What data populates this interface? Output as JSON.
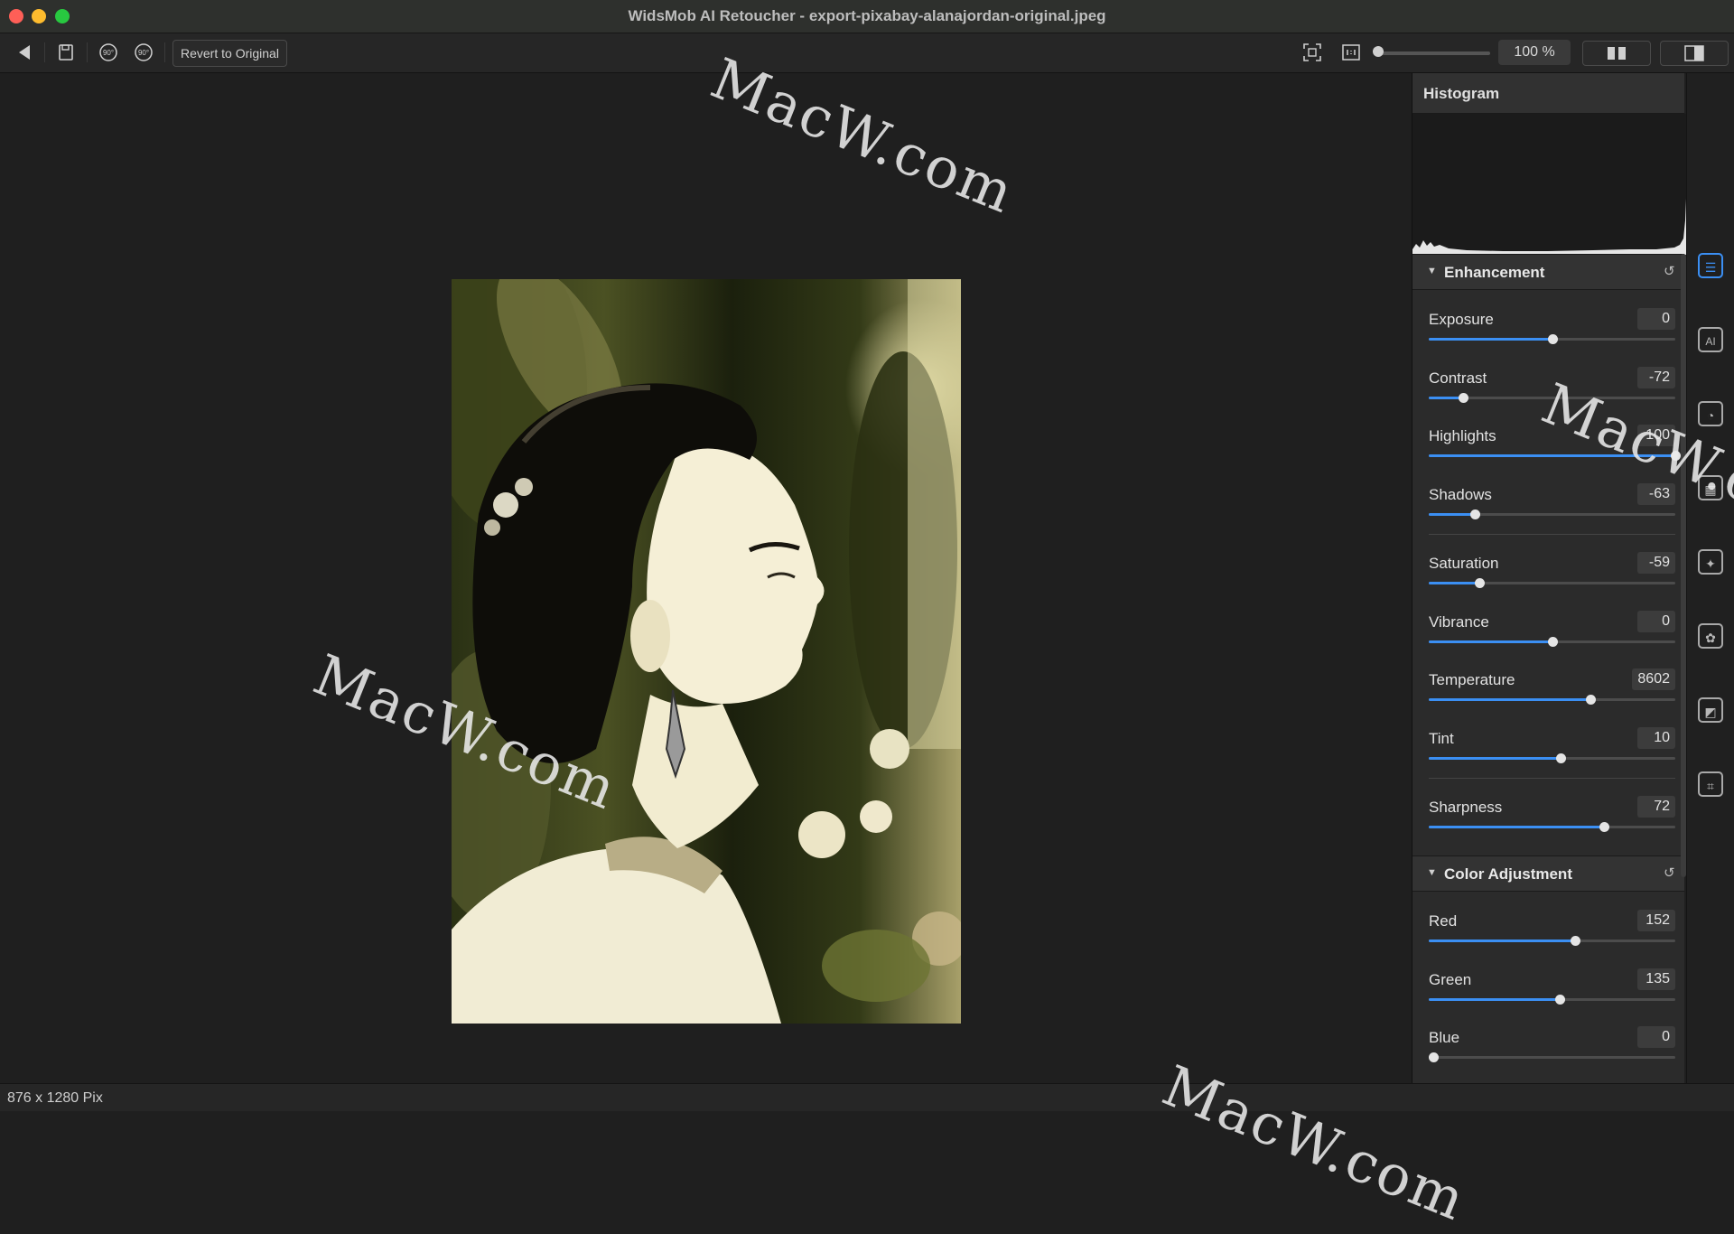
{
  "window": {
    "title": "WidsMob AI Retoucher - export-pixabay-alanajordan-original.jpeg"
  },
  "toolbar": {
    "back_icon": "back-arrow-icon",
    "save_icon": "save-icon",
    "rotate_left_label": "90°",
    "rotate_right_label": "90°",
    "revert_label": "Revert to Original",
    "fit_icon": "fit-to-screen-icon",
    "actual_size_icon": "actual-size-icon",
    "zoom_value": "100 %",
    "zoom_level": 0.0
  },
  "histogram": {
    "title": "Histogram",
    "expand_icon": "expand-icon"
  },
  "enhancement": {
    "title": "Enhancement",
    "reset_icon": "reset-icon",
    "rows": [
      {
        "label": "Exposure",
        "value": "0",
        "fraction": 0.5
      },
      {
        "label": "Contrast",
        "value": "-72",
        "fraction": 0.14
      },
      {
        "label": "Highlights",
        "value": "100",
        "fraction": 1.0
      },
      {
        "label": "Shadows",
        "value": "-63",
        "fraction": 0.185
      },
      {
        "label": "Saturation",
        "value": "-59",
        "fraction": 0.205
      },
      {
        "label": "Vibrance",
        "value": "0",
        "fraction": 0.5
      },
      {
        "label": "Temperature",
        "value": "8602",
        "fraction": 0.655
      },
      {
        "label": "Tint",
        "value": "10",
        "fraction": 0.535
      },
      {
        "label": "Sharpness",
        "value": "72",
        "fraction": 0.71
      }
    ]
  },
  "color_adjustment": {
    "title": "Color Adjustment",
    "reset_icon": "reset-icon",
    "rows": [
      {
        "label": "Red",
        "value": "152",
        "fraction": 0.595
      },
      {
        "label": "Green",
        "value": "135",
        "fraction": 0.53
      },
      {
        "label": "Blue",
        "value": "0",
        "fraction": 0.0
      }
    ]
  },
  "tools": [
    {
      "name": "adjustments-tool",
      "glyph": "☰",
      "active": true
    },
    {
      "name": "ai-tool",
      "glyph": "AI",
      "active": false
    },
    {
      "name": "portrait-tool",
      "glyph": "◔",
      "active": false
    },
    {
      "name": "noise-tool",
      "glyph": "▦",
      "active": false
    },
    {
      "name": "magic-wand-tool",
      "glyph": "✦",
      "active": false
    },
    {
      "name": "filter-tool",
      "glyph": "✿",
      "active": false
    },
    {
      "name": "frame-tool",
      "glyph": "◩",
      "active": false
    },
    {
      "name": "crop-tool",
      "glyph": "⌗",
      "active": false
    }
  ],
  "status": {
    "dimensions": "876 x 1280 Pix"
  },
  "watermark": "MacW.com",
  "colors": {
    "accent": "#3b8ff3",
    "panel": "#2b2b2b",
    "canvas": "#1f1f1f"
  }
}
